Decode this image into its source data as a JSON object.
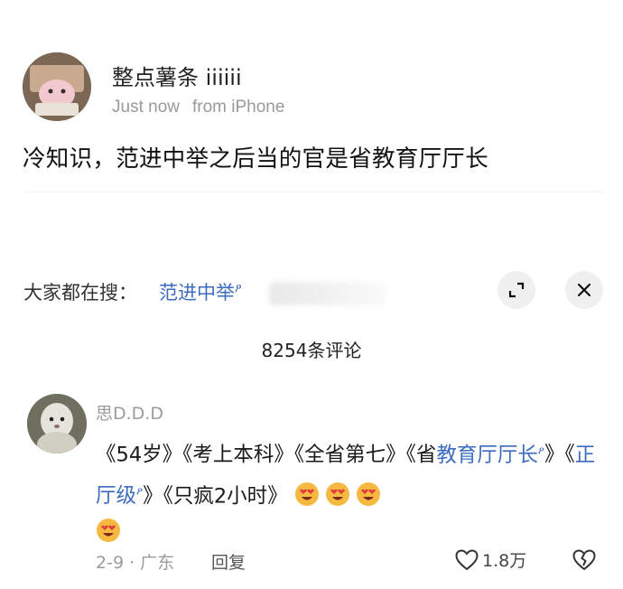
{
  "post": {
    "author": "整点薯条 iiiiii",
    "time": "Just now",
    "source": "from iPhone",
    "text": "冷知识，范进中举之后当的官是省教育厅厅长"
  },
  "search": {
    "prefix": "大家都在搜：",
    "query": "范进中举"
  },
  "comments": {
    "count_label": "8254条评论",
    "items": [
      {
        "author": "思D.D.D",
        "body": {
          "t1": "《54岁》《考上本科》《全省第七》《省",
          "link1": "教育厅厅长",
          "t2": "》《",
          "link2": "正厅级",
          "t3": "》《只疯2小时》"
        },
        "emoji_count": 4,
        "date_location": "2-9 · 广东",
        "reply_label": "回复",
        "likes": "1.8万"
      }
    ]
  },
  "colors": {
    "link": "#3d6bbf",
    "muted": "#9c9c9c"
  }
}
